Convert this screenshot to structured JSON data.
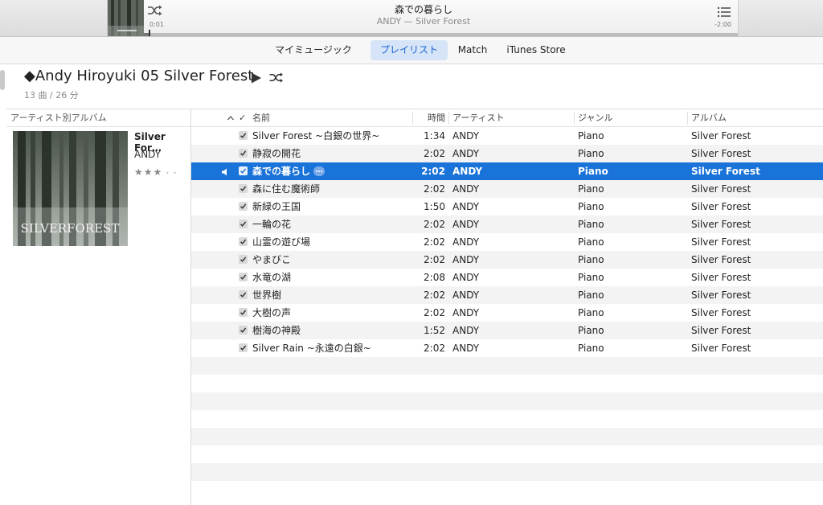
{
  "now_playing": {
    "title": "森での暮らし",
    "subtitle": "ANDY — Silver Forest",
    "elapsed": "0:01",
    "remaining": "-2:00",
    "progress": 0.008
  },
  "nav": {
    "tabs": [
      {
        "label": "マイミュージック",
        "selected": false
      },
      {
        "label": "プレイリスト",
        "selected": true
      },
      {
        "label": "Match",
        "selected": false
      },
      {
        "label": "iTunes Store",
        "selected": false
      }
    ]
  },
  "playlist": {
    "title": "◆Andy Hiroyuki 05 Silver Forest",
    "meta": "13 曲 / 26 分"
  },
  "album_pane": {
    "header": "アーティスト別アルバム",
    "album_title": "Silver For…",
    "artist": "ANDY",
    "rating": 3,
    "art_text": "SILVERFOREST"
  },
  "table": {
    "columns": {
      "check": "✓",
      "name": "名前",
      "time": "時間",
      "artist": "アーティスト",
      "genre": "ジャンル",
      "album": "アルバム"
    },
    "tracks": [
      {
        "name": "Silver Forest ~白銀の世界~",
        "time": "1:34",
        "artist": "ANDY",
        "genre": "Piano",
        "album": "Silver Forest"
      },
      {
        "name": "静寂の開花",
        "time": "2:02",
        "artist": "ANDY",
        "genre": "Piano",
        "album": "Silver Forest"
      },
      {
        "name": "森での暮らし",
        "time": "2:02",
        "artist": "ANDY",
        "genre": "Piano",
        "album": "Silver Forest",
        "playing": true
      },
      {
        "name": "森に住む魔術師",
        "time": "2:02",
        "artist": "ANDY",
        "genre": "Piano",
        "album": "Silver Forest"
      },
      {
        "name": "新緑の王国",
        "time": "1:50",
        "artist": "ANDY",
        "genre": "Piano",
        "album": "Silver Forest"
      },
      {
        "name": "一輪の花",
        "time": "2:02",
        "artist": "ANDY",
        "genre": "Piano",
        "album": "Silver Forest"
      },
      {
        "name": "山霊の遊び場",
        "time": "2:02",
        "artist": "ANDY",
        "genre": "Piano",
        "album": "Silver Forest"
      },
      {
        "name": "やまびこ",
        "time": "2:02",
        "artist": "ANDY",
        "genre": "Piano",
        "album": "Silver Forest"
      },
      {
        "name": "水竜の湖",
        "time": "2:08",
        "artist": "ANDY",
        "genre": "Piano",
        "album": "Silver Forest"
      },
      {
        "name": "世界樹",
        "time": "2:02",
        "artist": "ANDY",
        "genre": "Piano",
        "album": "Silver Forest"
      },
      {
        "name": "大樹の声",
        "time": "2:02",
        "artist": "ANDY",
        "genre": "Piano",
        "album": "Silver Forest"
      },
      {
        "name": "樹海の神殿",
        "time": "1:52",
        "artist": "ANDY",
        "genre": "Piano",
        "album": "Silver Forest"
      },
      {
        "name": "Silver Rain ~永遠の白銀~",
        "time": "2:02",
        "artist": "ANDY",
        "genre": "Piano",
        "album": "Silver Forest"
      }
    ]
  },
  "colors": {
    "selection": "#1a73d9",
    "tab_selected_bg": "#d6e4f7",
    "tab_selected_text": "#1b63d6"
  },
  "icons": {
    "shuffle": "shuffle-icon",
    "up_next": "list-icon",
    "play": "play-icon",
    "speaker": "speaker-icon",
    "check": "checkmark-icon",
    "more": "more-icon",
    "sort": "chevron-up-icon"
  }
}
